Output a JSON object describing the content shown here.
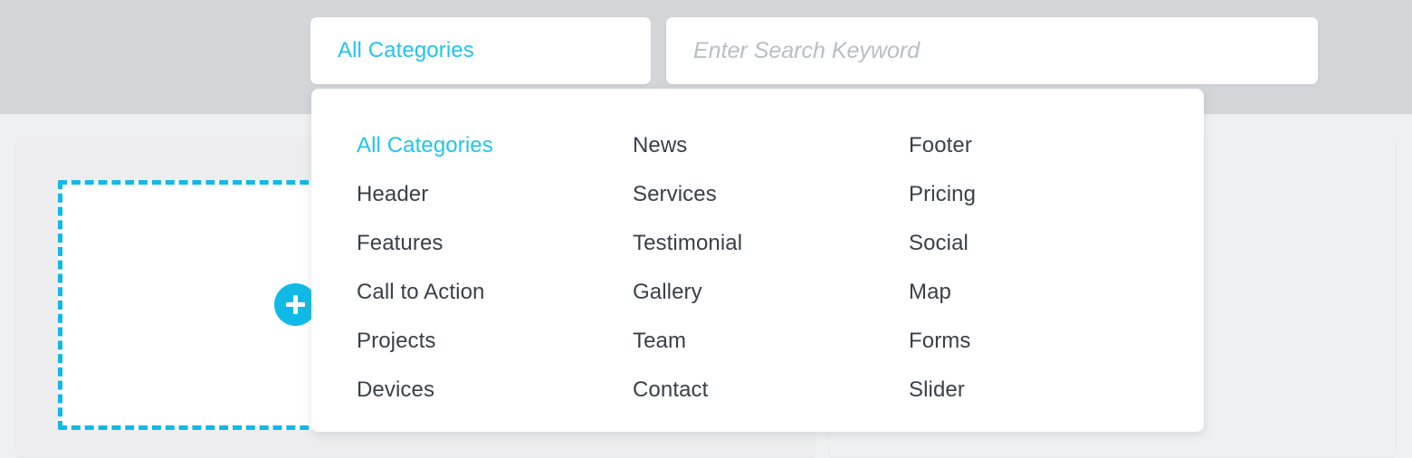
{
  "colors": {
    "accent": "#22c4ec",
    "accent_button": "#10bae6",
    "dashed_border": "#11b9e6",
    "text_dark": "#3a4049",
    "placeholder_gray": "#b9bec4",
    "toolbar_band": "#d2d6d9",
    "canvas_bg": "#eff0f2",
    "panel_white": "#ffffff"
  },
  "toolbar": {
    "category_select": {
      "selected_label": "All Categories"
    },
    "search": {
      "value": "",
      "placeholder": "Enter Search Keyword"
    }
  },
  "dropdown": {
    "columns": [
      {
        "items": [
          {
            "label": "All Categories",
            "active": true
          },
          {
            "label": "Header",
            "active": false
          },
          {
            "label": "Features",
            "active": false
          },
          {
            "label": "Call to Action",
            "active": false
          },
          {
            "label": "Projects",
            "active": false
          },
          {
            "label": "Devices",
            "active": false
          }
        ]
      },
      {
        "items": [
          {
            "label": "News",
            "active": false
          },
          {
            "label": "Services",
            "active": false
          },
          {
            "label": "Testimonial",
            "active": false
          },
          {
            "label": "Gallery",
            "active": false
          },
          {
            "label": "Team",
            "active": false
          },
          {
            "label": "Contact",
            "active": false
          }
        ]
      },
      {
        "items": [
          {
            "label": "Footer",
            "active": false
          },
          {
            "label": "Pricing",
            "active": false
          },
          {
            "label": "Social",
            "active": false
          },
          {
            "label": "Map",
            "active": false
          },
          {
            "label": "Forms",
            "active": false
          },
          {
            "label": "Slider",
            "active": false
          }
        ]
      }
    ]
  },
  "canvas": {
    "add_block_button": {
      "icon": "plus-icon",
      "label": "+"
    },
    "drop_placeholder": {
      "label": ""
    }
  }
}
